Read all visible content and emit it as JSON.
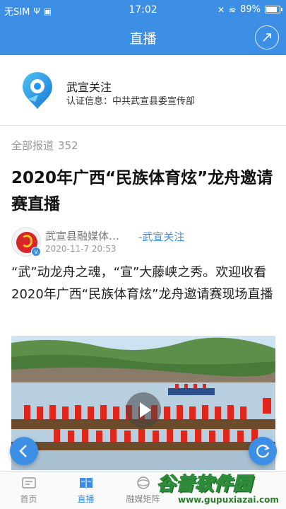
{
  "status_bar": {
    "carrier": "无SIM",
    "time": "17:02",
    "battery": "89%",
    "battery_level": 0.89
  },
  "nav": {
    "title": "直播"
  },
  "account": {
    "name": "武宣关注",
    "certification": "认证信息：中共武宣县委宣传部"
  },
  "report_count": {
    "label": "全部报道",
    "value": "352"
  },
  "article": {
    "title": "2020年广西“民族体育炫”龙舟邀请赛直播",
    "author_name": "武宣县融媒体…",
    "author_tag": "-武宣关注",
    "date": "2020-11-7 20:53",
    "summary": "“武”动龙舟之魂，“宣”大藤峡之秀。欢迎收看2020年广西“民族体育炫”龙舟邀请赛现场直播"
  },
  "tabbar": {
    "items": [
      {
        "label": "首页",
        "icon": "home-icon"
      },
      {
        "label": "直播",
        "icon": "book-icon",
        "active": true
      },
      {
        "label": "融媒矩阵",
        "icon": "globe-icon"
      },
      {
        "label": "",
        "icon": "tab-icon"
      },
      {
        "label": "",
        "icon": "tab-icon"
      }
    ]
  },
  "watermark": {
    "title": "谷普软件园",
    "url": "www.gupuxiazai.com"
  },
  "colors": {
    "primary": "#3d8fe6",
    "muted": "#999999"
  }
}
